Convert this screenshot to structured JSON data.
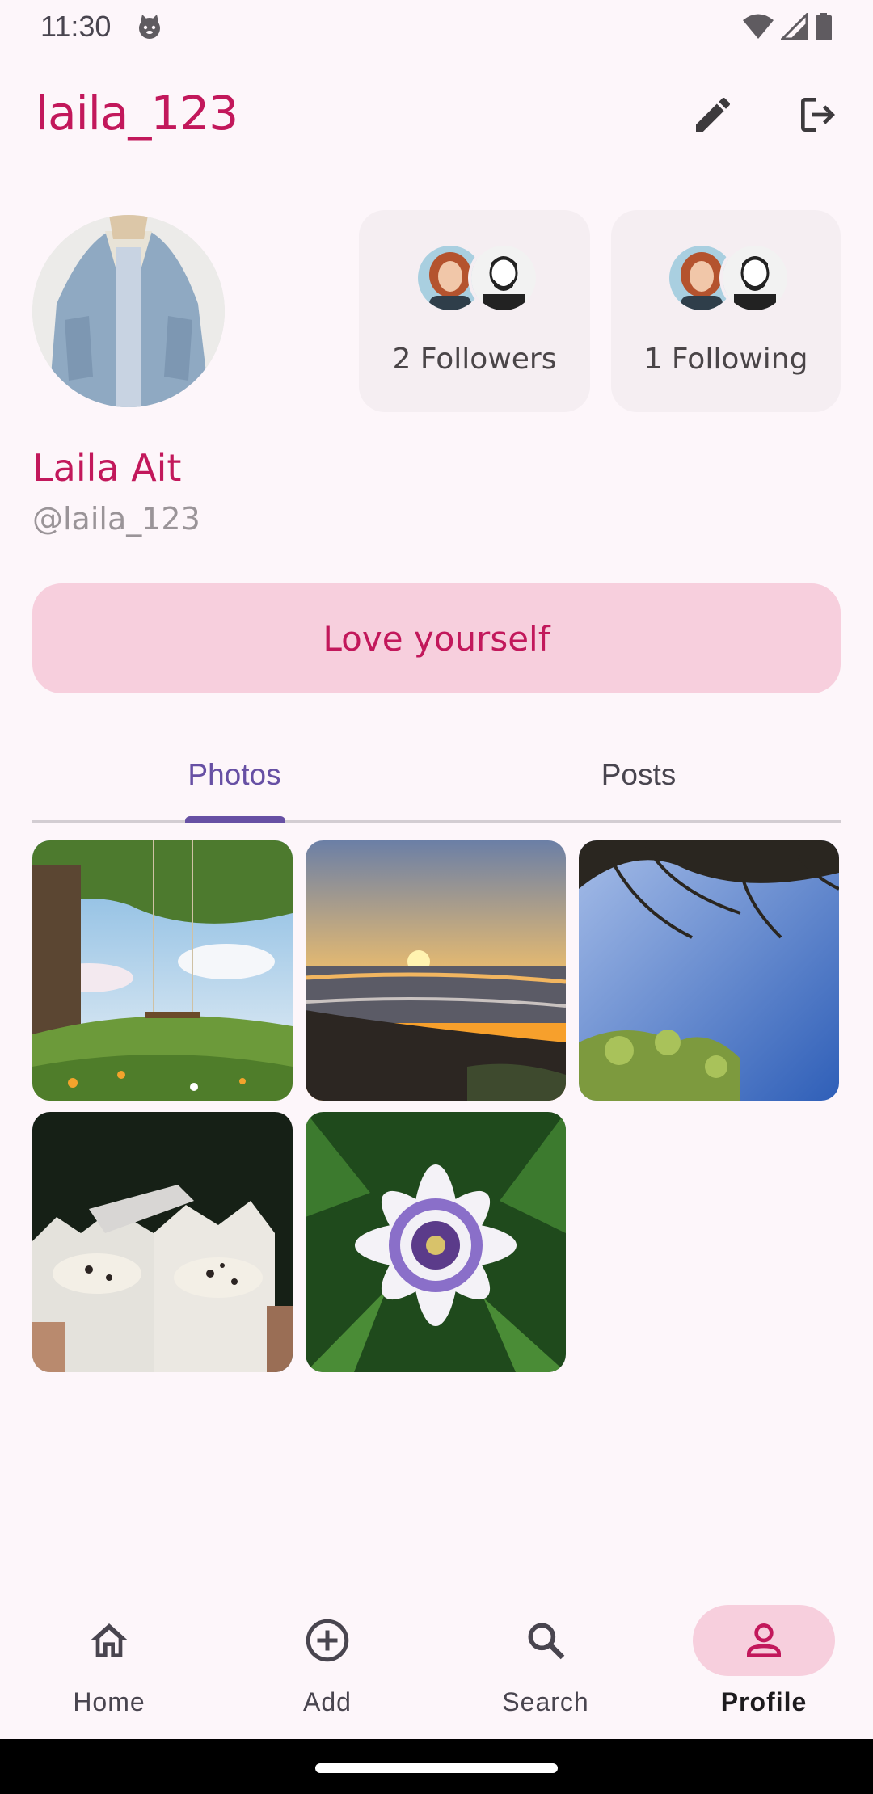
{
  "status_bar": {
    "time": "11:30"
  },
  "app_bar": {
    "title": "laila_123",
    "edit_icon": "pencil-icon",
    "logout_icon": "logout-icon"
  },
  "profile": {
    "display_name": "Laila Ait",
    "handle": "@laila_123",
    "bio": "Love yourself",
    "followers_label": "2 Followers",
    "following_label": "1 Following"
  },
  "tabs": [
    {
      "label": "Photos",
      "selected": true
    },
    {
      "label": "Posts",
      "selected": false
    }
  ],
  "photos": [
    {
      "subject": "tree-swing-meadow"
    },
    {
      "subject": "sunset-over-sea"
    },
    {
      "subject": "tree-branches-sky"
    },
    {
      "subject": "ice-cream-cups"
    },
    {
      "subject": "passion-flower"
    }
  ],
  "bottom_nav": [
    {
      "label": "Home",
      "icon": "home-icon",
      "selected": false
    },
    {
      "label": "Add",
      "icon": "add-circle-icon",
      "selected": false
    },
    {
      "label": "Search",
      "icon": "search-icon",
      "selected": false
    },
    {
      "label": "Profile",
      "icon": "person-icon",
      "selected": true
    }
  ],
  "colors": {
    "accent": "#c2185b",
    "tab_selected": "#6750a4",
    "bio_background": "#f7cfdd",
    "background": "#fdf6fa"
  }
}
